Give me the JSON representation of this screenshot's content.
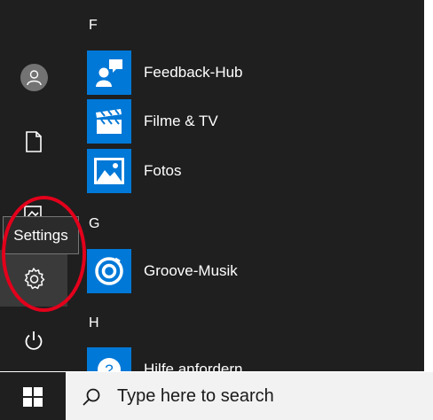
{
  "start_menu": {
    "sections": [
      {
        "letter": "F",
        "apps": [
          {
            "label": "Feedback-Hub",
            "icon": "feedback-hub-icon"
          },
          {
            "label": "Filme & TV",
            "icon": "film-tv-icon"
          },
          {
            "label": "Fotos",
            "icon": "photos-icon"
          }
        ]
      },
      {
        "letter": "G",
        "apps": [
          {
            "label": "Groove-Musik",
            "icon": "groove-music-icon"
          }
        ]
      },
      {
        "letter": "H",
        "apps": [
          {
            "label": "Hilfe anfordern",
            "icon": "get-help-icon"
          }
        ]
      }
    ],
    "rail": {
      "items": [
        "user-avatar-icon",
        "document-icon",
        "pictures-icon",
        "gear-icon",
        "power-icon"
      ],
      "tooltip": "Settings"
    }
  },
  "taskbar": {
    "start_icon": "windows-logo-icon",
    "search_icon": "search-icon",
    "search_placeholder": "Type here to search"
  },
  "colors": {
    "menu_background": "#1f1f1f",
    "tile_blue": "#0078d7",
    "annotation_red": "#e3001b"
  }
}
